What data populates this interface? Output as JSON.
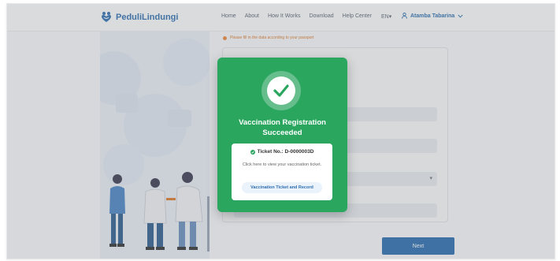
{
  "header": {
    "brand": "PeduliLindungi",
    "nav": [
      "Home",
      "About",
      "How It Works",
      "Download",
      "Help Center"
    ],
    "language": "EN",
    "user_name": "Atamba Tabarina"
  },
  "form": {
    "notice": "Please fill in the data according to your passport",
    "next_label": "Next"
  },
  "modal": {
    "title": "Vaccination Registration Succeeded",
    "ticket_no": "Ticket No.: D-0000003D",
    "description": "Click here to view your vaccination ticket.",
    "button_label": "Vaccination Ticket and Record"
  },
  "colors": {
    "success_green": "#2aa65f",
    "brand_blue": "#2a6db1",
    "warning_orange": "#f0883e"
  }
}
